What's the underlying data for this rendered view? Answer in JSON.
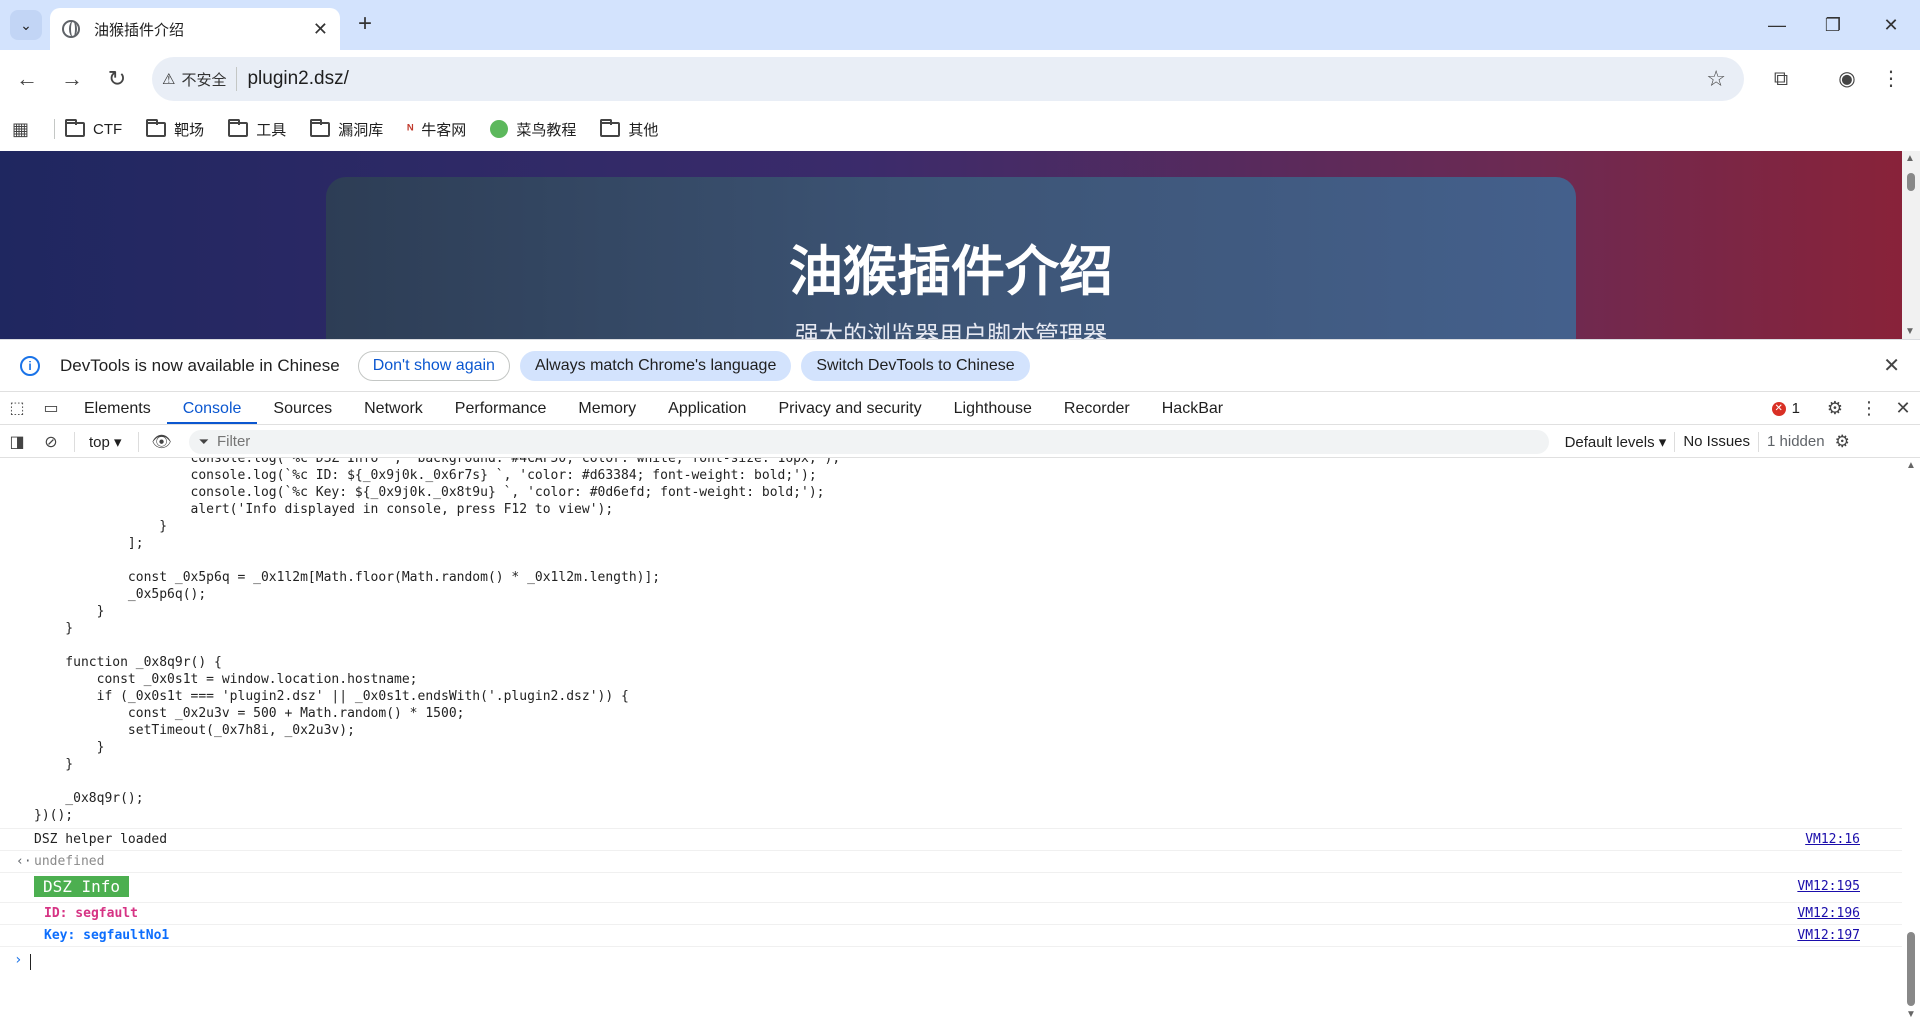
{
  "browser": {
    "tab_title": "油猴插件介绍",
    "omnibox": {
      "security_label": "不安全",
      "url": "plugin2.dsz/"
    },
    "bookmarks": [
      {
        "label": "CTF",
        "icon": "folder-icon"
      },
      {
        "label": "靶场",
        "icon": "folder-icon"
      },
      {
        "label": "工具",
        "icon": "folder-icon"
      },
      {
        "label": "漏洞库",
        "icon": "folder-icon"
      },
      {
        "label": "牛客网",
        "icon": "nowcoder-icon"
      },
      {
        "label": "菜鸟教程",
        "icon": "runoob-icon"
      },
      {
        "label": "其他",
        "icon": "folder-icon"
      }
    ]
  },
  "page": {
    "title": "油猴插件介绍",
    "subtitle": "强大的浏览器用户脚本管理器"
  },
  "devtools": {
    "infobar": {
      "message": "DevTools is now available in Chinese",
      "dont_show": "Don't show again",
      "always_match": "Always match Chrome's language",
      "switch": "Switch DevTools to Chinese"
    },
    "tabs": [
      "Elements",
      "Console",
      "Sources",
      "Network",
      "Performance",
      "Memory",
      "Application",
      "Privacy and security",
      "Lighthouse",
      "Recorder",
      "HackBar"
    ],
    "active_tab": "Console",
    "error_count": "1",
    "console_toolbar": {
      "context": "top",
      "filter_placeholder": "Filter",
      "levels": "Default levels",
      "issues": "No Issues",
      "hidden": "1 hidden"
    },
    "console": {
      "messages": [
        {
          "text": "DSZ helper loaded",
          "source": "VM12:16"
        },
        {
          "text": "undefined"
        },
        {
          "text": "DSZ Info",
          "source": "VM12:195"
        },
        {
          "text": "ID: segfault",
          "source": "VM12:196"
        },
        {
          "text": "Key: segfaultNo1",
          "source": "VM12:197"
        }
      ]
    }
  },
  "colors": {
    "dsz_badge_bg": "#4CAF50",
    "id_color": "#d63384",
    "key_color": "#0d6efd",
    "accent": "#0b57d0"
  }
}
